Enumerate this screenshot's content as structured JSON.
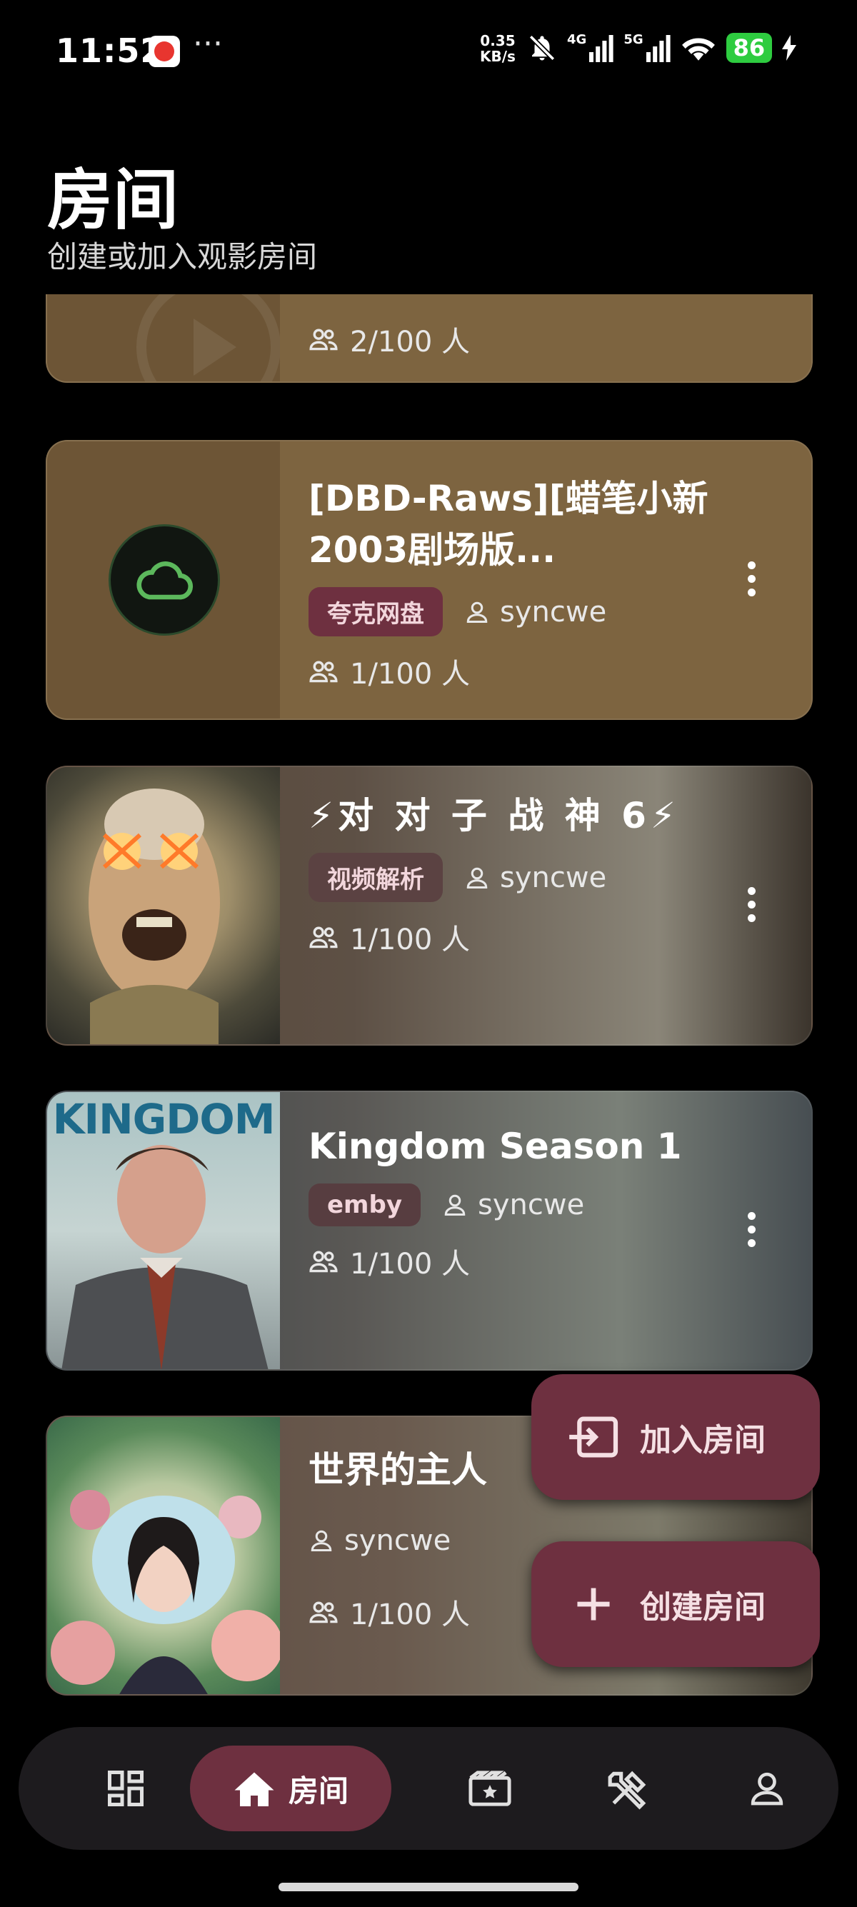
{
  "status_bar": {
    "time": "11:52",
    "more": "···",
    "speed_value": "0.35",
    "speed_unit": "KB/s",
    "net1": "4G",
    "net2": "5G",
    "battery": "86"
  },
  "header": {
    "title": "房间",
    "subtitle": "创建或加入观影房间"
  },
  "rooms": [
    {
      "title": "",
      "tag": "",
      "owner": "",
      "count": "2/100 人"
    },
    {
      "title": "[DBD-Raws][蜡笔小新2003剧场版...",
      "tag": "夸克网盘",
      "owner": "syncwe",
      "count": "1/100 人"
    },
    {
      "title": "⚡对 对 子 战 神 6⚡",
      "tag": "视频解析",
      "owner": "syncwe",
      "count": "1/100 人"
    },
    {
      "title": "Kingdom Season 1",
      "tag": "emby",
      "owner": "syncwe",
      "count": "1/100 人",
      "thumb_text": "KINGDOM"
    },
    {
      "title": "世界的主人",
      "tag": "",
      "owner": "syncwe",
      "count": "1/100 人"
    }
  ],
  "fabs": {
    "join": "加入房间",
    "create": "创建房间"
  },
  "nav": {
    "items": [
      "dashboard",
      "rooms",
      "movies",
      "tools",
      "profile"
    ],
    "active_label": "房间"
  },
  "colors": {
    "accent": "#6e3040",
    "card_brown": "#7d6440",
    "background": "#000000"
  }
}
